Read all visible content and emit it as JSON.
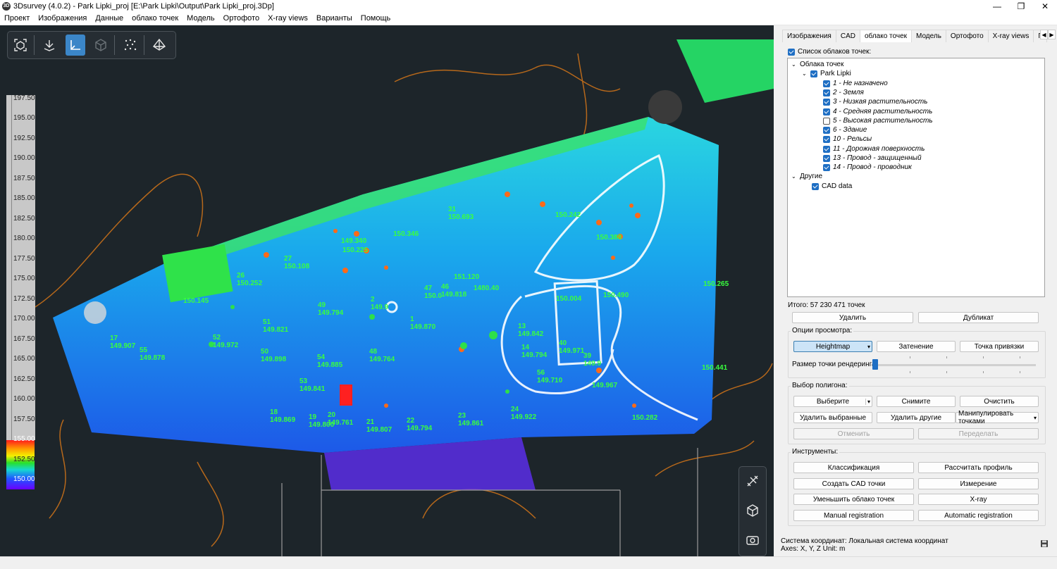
{
  "window": {
    "title": "3Dsurvey (4.0.2) - Park Lipki_proj [E:\\Park Lipki\\Output\\Park Lipki_proj.3Dp]",
    "minimize": "—",
    "maximize": "❐",
    "close": "✕"
  },
  "menu": [
    "Проект",
    "Изображения",
    "Данные",
    "облако точек",
    "Модель",
    "Ортофото",
    "X-ray views",
    "Варианты",
    "Помощь"
  ],
  "viewport": {
    "toolbar_icons": [
      "fit-view-icon",
      "download-icon",
      "axes-icon",
      "cube-icon",
      "points-icon",
      "pyramid-icon"
    ],
    "scale_ticks": [
      "197.50",
      "195.00",
      "192.50",
      "190.00",
      "187.50",
      "185.00",
      "182.50",
      "180.00",
      "177.50",
      "175.00",
      "172.50",
      "170.00",
      "167.50",
      "165.00",
      "162.50",
      "160.00",
      "157.50",
      "155.00",
      "152.50",
      "150.00"
    ],
    "side_icons": [
      "drone-icon",
      "cube-export-icon",
      "camera-icon"
    ],
    "labels": [
      {
        "t": "27\n150.108"
      },
      {
        "t": "26\n150.252"
      },
      {
        "t": "150.145"
      },
      {
        "t": "49\n149.794"
      },
      {
        "t": "2\n149.9"
      },
      {
        "t": "47\n150.0"
      },
      {
        "t": "46\n149.818"
      },
      {
        "t": "151.120"
      },
      {
        "t": "1480.40"
      },
      {
        "t": "1\n149.870"
      },
      {
        "t": "51\n149.821"
      },
      {
        "t": "52\n149.972"
      },
      {
        "t": "17\n149.907"
      },
      {
        "t": "55\n149.878"
      },
      {
        "t": "50\n149.898"
      },
      {
        "t": "54\n149.885"
      },
      {
        "t": "48\n149.764"
      },
      {
        "t": "53\n149.841"
      },
      {
        "t": "18\n149.869"
      },
      {
        "t": "19\n149.800"
      },
      {
        "t": "20\n149.761"
      },
      {
        "t": "21\n149.807"
      },
      {
        "t": "22\n149.794"
      },
      {
        "t": "23\n149.861"
      },
      {
        "t": "24\n149.922"
      },
      {
        "t": "31\n150.693"
      },
      {
        "t": "149.340"
      },
      {
        "t": "150.225"
      },
      {
        "t": "150.346"
      },
      {
        "t": "150.004"
      },
      {
        "t": "13\n149.842"
      },
      {
        "t": "14\n149.794"
      },
      {
        "t": "40\n149.971"
      },
      {
        "t": "39\n149.9"
      },
      {
        "t": "56\n149.710"
      },
      {
        "t": "149.967"
      },
      {
        "t": "150.282"
      },
      {
        "t": "150.441"
      },
      {
        "t": "150.265"
      },
      {
        "t": "150.242"
      },
      {
        "t": "150.490"
      },
      {
        "t": "150.388"
      }
    ]
  },
  "panel": {
    "tabs": [
      "Изображения",
      "CAD",
      "облако точек",
      "Модель",
      "Ортофото",
      "X-ray views",
      "Г"
    ],
    "active_tab": 2,
    "list_toggle": "Список облаков точек:",
    "tree": {
      "root": "Облака точек",
      "project": "Park Lipki",
      "classes": [
        {
          "label": "1 - Не назначено",
          "checked": true
        },
        {
          "label": "2 - Земля",
          "checked": true
        },
        {
          "label": "3 - Низкая растительность",
          "checked": true
        },
        {
          "label": "4 - Средняя растительность",
          "checked": true
        },
        {
          "label": "5 - Высокая растительность",
          "checked": false
        },
        {
          "label": "6 - Здание",
          "checked": true
        },
        {
          "label": "10 - Рельсы",
          "checked": true
        },
        {
          "label": "11 - Дорожная поверхность",
          "checked": true
        },
        {
          "label": "13 - Провод - защищенный",
          "checked": true
        },
        {
          "label": "14 - Провод - проводник",
          "checked": true
        }
      ],
      "other": "Другие",
      "cad": "CAD data"
    },
    "total": "Итого: 57 230 471 точек",
    "delete": "Удалить",
    "duplicate": "Дубликат",
    "view_options": {
      "title": "Опции просмотра:",
      "heightmap": "Heightmap",
      "shading": "Затенение",
      "snap": "Точка привязки",
      "point_size": "Размер точки рендеринга:",
      "point_size_value": 0.0
    },
    "polygon": {
      "title": "Выбор полигона:",
      "select": "Выберите",
      "deselect": "Снимите",
      "clear": "Очистить",
      "delete_selected": "Удалить выбранные",
      "delete_others": "Удалить другие",
      "manipulate": "Манипулировать точками",
      "undo": "Отменить",
      "redo": "Переделать"
    },
    "tools": {
      "title": "Инструменты:",
      "classification": "Классификация",
      "profile": "Рассчитать профиль",
      "cad_points": "Создать CAD точки",
      "measure": "Измерение",
      "reduce": "Уменьшить облако точек",
      "xray": "X-ray",
      "manual_reg": "Manual registration",
      "auto_reg": "Automatic registration"
    },
    "coord_system": "Система координат: Локальная система координат",
    "axes": "Axes: X, Y, Z Unit: m"
  }
}
